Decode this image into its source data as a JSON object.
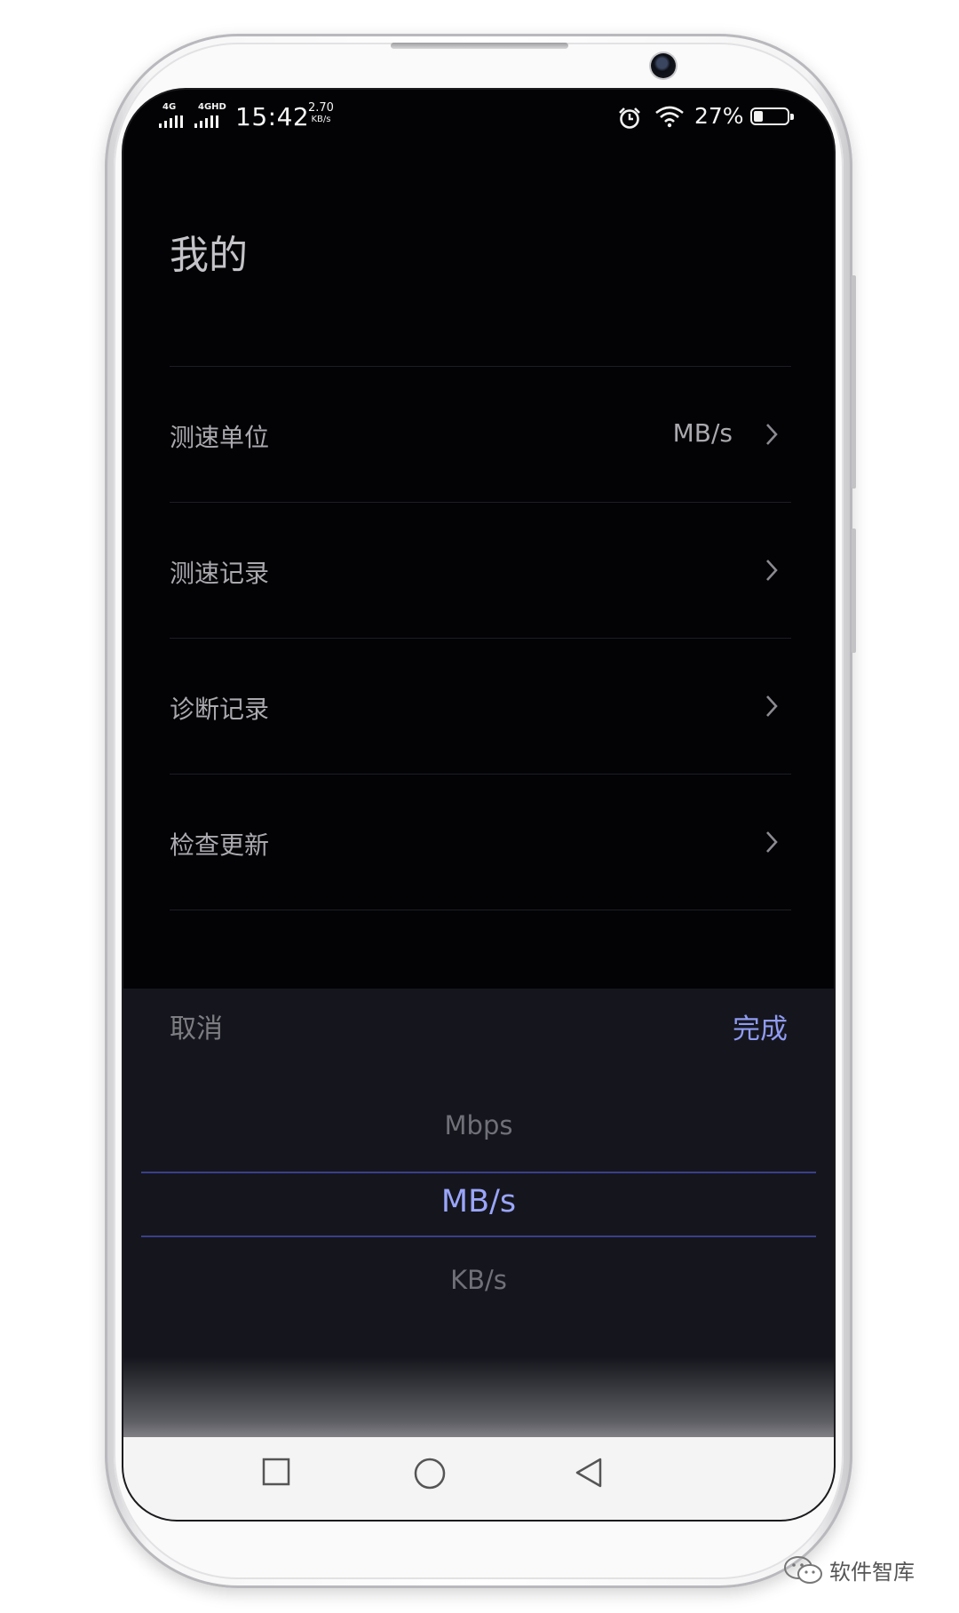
{
  "status_bar": {
    "sim1": "4G",
    "sim2": "4GHD",
    "time": "15:42",
    "net_speed_value": "2.70",
    "net_speed_unit": "KB/s",
    "battery_percent": "27%",
    "battery_level": 0.27
  },
  "page": {
    "title": "我的"
  },
  "settings": [
    {
      "label": "测速单位",
      "value": "MB/s"
    },
    {
      "label": "测速记录",
      "value": ""
    },
    {
      "label": "诊断记录",
      "value": ""
    },
    {
      "label": "检查更新",
      "value": ""
    }
  ],
  "picker": {
    "cancel_label": "取消",
    "done_label": "完成",
    "options": [
      "Mbps",
      "MB/s",
      "KB/s"
    ],
    "selected": "MB/s"
  },
  "navigation": {
    "recent": "square-icon",
    "home": "circle-icon",
    "back": "triangle-icon"
  },
  "watermark": {
    "text": "软件智库"
  },
  "colors": {
    "accent": "#9aa5fb",
    "background": "#030306",
    "sheet": "#15161d"
  }
}
